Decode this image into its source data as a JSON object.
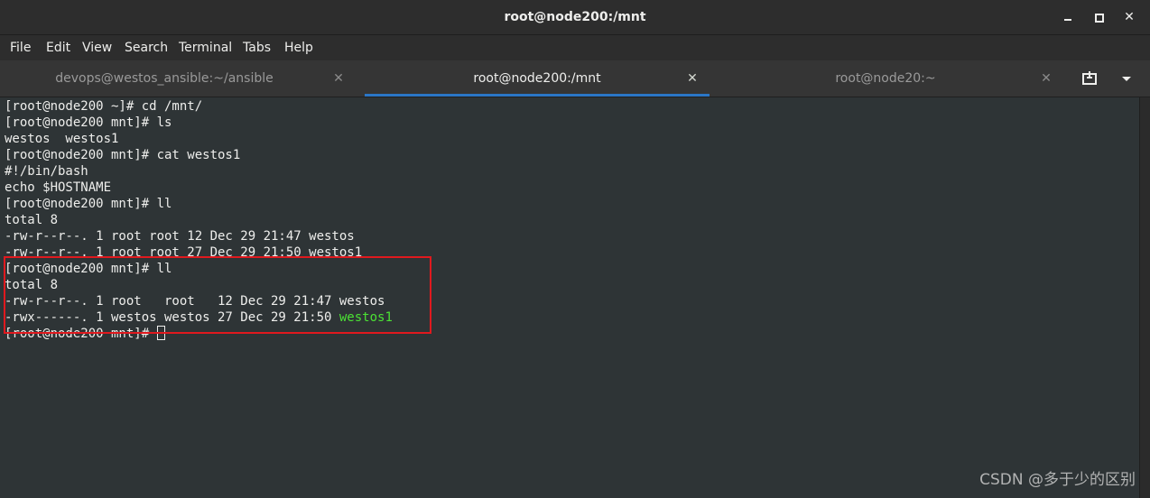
{
  "window": {
    "title": "root@node200:/mnt"
  },
  "menubar": {
    "items": [
      "File",
      "Edit",
      "View",
      "Search",
      "Terminal",
      "Tabs",
      "Help"
    ]
  },
  "tabs": [
    {
      "label": "devops@westos_ansible:~/ansible",
      "active": false
    },
    {
      "label": "root@node200:/mnt",
      "active": true
    },
    {
      "label": "root@node20:~",
      "active": false
    }
  ],
  "terminal": {
    "lines": [
      "[root@node200 ~]# cd /mnt/",
      "[root@node200 mnt]# ls",
      "westos  westos1",
      "[root@node200 mnt]# cat westos1",
      "#!/bin/bash",
      "echo $HOSTNAME",
      "[root@node200 mnt]# ll",
      "total 8",
      "-rw-r--r--. 1 root root 12 Dec 29 21:47 westos",
      "-rw-r--r--. 1 root root 27 Dec 29 21:50 westos1",
      "[root@node200 mnt]# ll",
      "total 8",
      "-rw-r--r--. 1 root   root   12 Dec 29 21:47 westos",
      "-rwx------. 1 westos westos 27 Dec 29 21:50 ",
      "[root@node200 mnt]# "
    ],
    "executable_file": "westos1",
    "executable_color": "#4be234"
  },
  "watermark": "CSDN @多于少的区别",
  "colors": {
    "highlight_box": "#e0191e",
    "active_tab_underline": "#2a76c6"
  }
}
